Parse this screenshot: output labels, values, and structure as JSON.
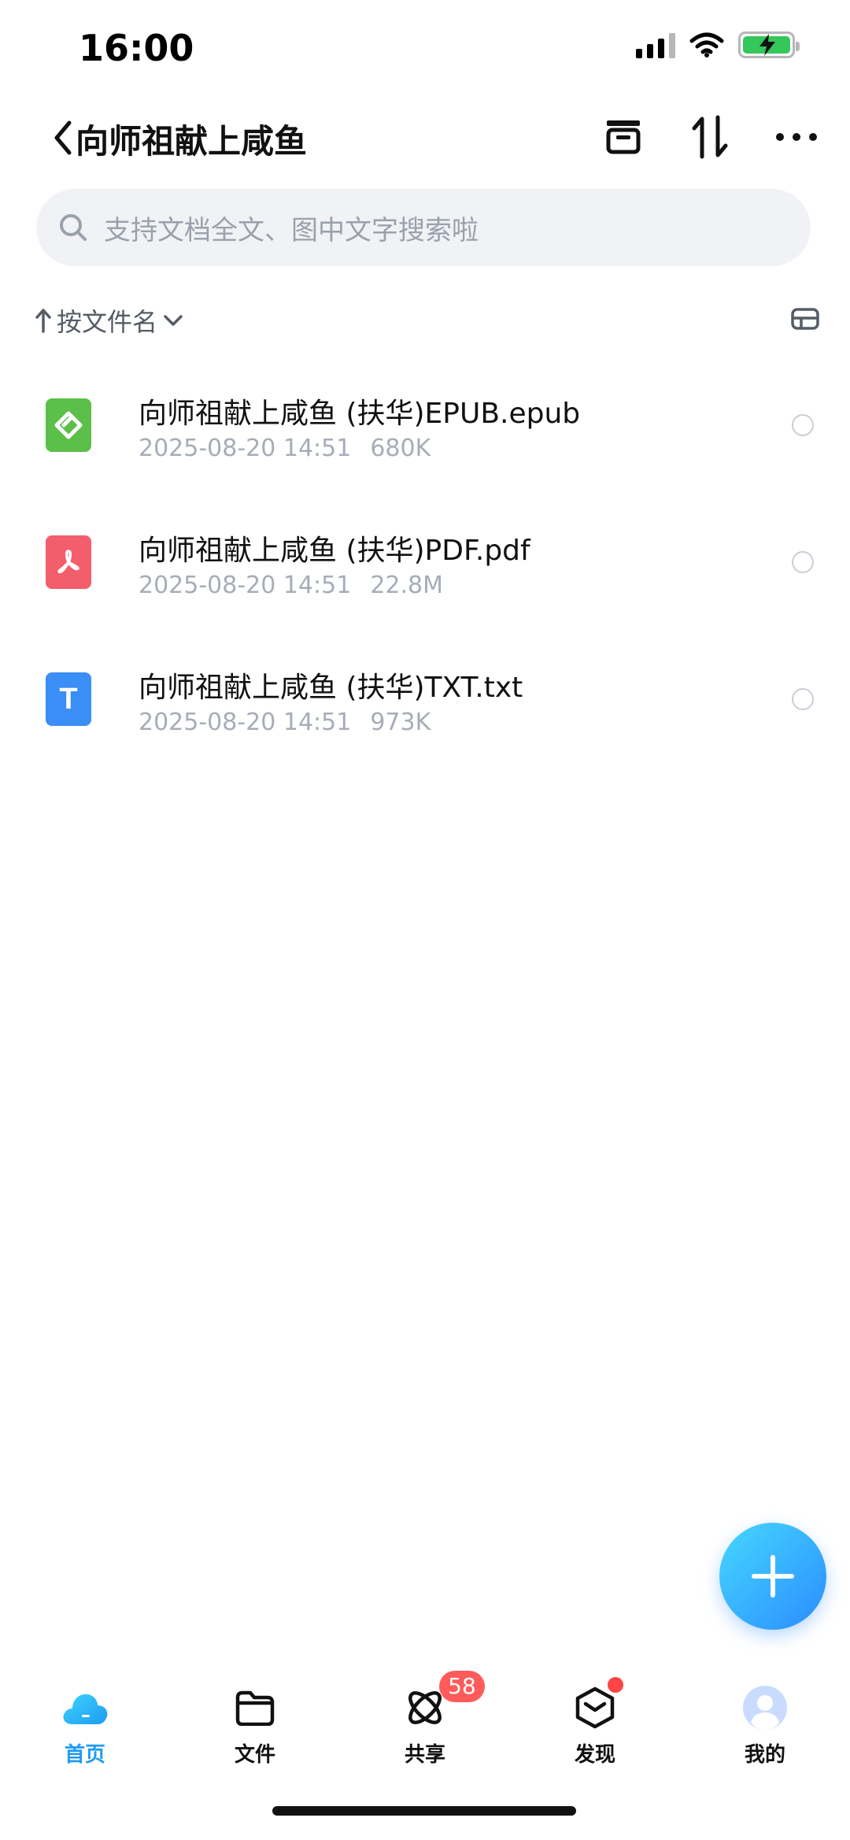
{
  "status_bar": {
    "time": "16:00"
  },
  "header": {
    "title": "向师祖献上咸鱼",
    "icons": [
      "back-icon",
      "archive-icon",
      "sort-icon",
      "more-icon"
    ]
  },
  "search": {
    "placeholder": "支持文档全文、图中文字搜索啦"
  },
  "sort": {
    "label": "按文件名"
  },
  "files": [
    {
      "name": "向师祖献上咸鱼 (扶华)EPUB.epub",
      "date": "2025-08-20 14:51",
      "size": "680K",
      "type": "epub",
      "color": "#5cbf4a"
    },
    {
      "name": "向师祖献上咸鱼 (扶华)PDF.pdf",
      "date": "2025-08-20 14:51",
      "size": "22.8M",
      "type": "pdf",
      "color": "#f25e6b"
    },
    {
      "name": "向师祖献上咸鱼 (扶华)TXT.txt",
      "date": "2025-08-20 14:51",
      "size": "973K",
      "type": "txt",
      "color": "#3a8ef6",
      "glyph": "T"
    }
  ],
  "tabbar": {
    "tabs": [
      {
        "label": "首页",
        "active": true
      },
      {
        "label": "文件"
      },
      {
        "label": "共享",
        "badge": "58"
      },
      {
        "label": "发现",
        "dot": true
      },
      {
        "label": "我的"
      }
    ]
  },
  "colors": {
    "accent": "#1e9bf0",
    "badge": "#ff5b5b"
  }
}
